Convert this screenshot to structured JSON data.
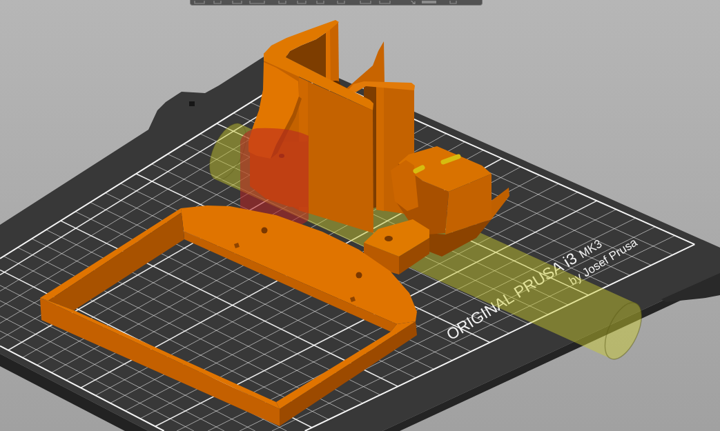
{
  "bed": {
    "logo": "ORIGINAL PRUSA i3",
    "logo_model": "MK3",
    "byline": "by Josef Prusa"
  }
}
